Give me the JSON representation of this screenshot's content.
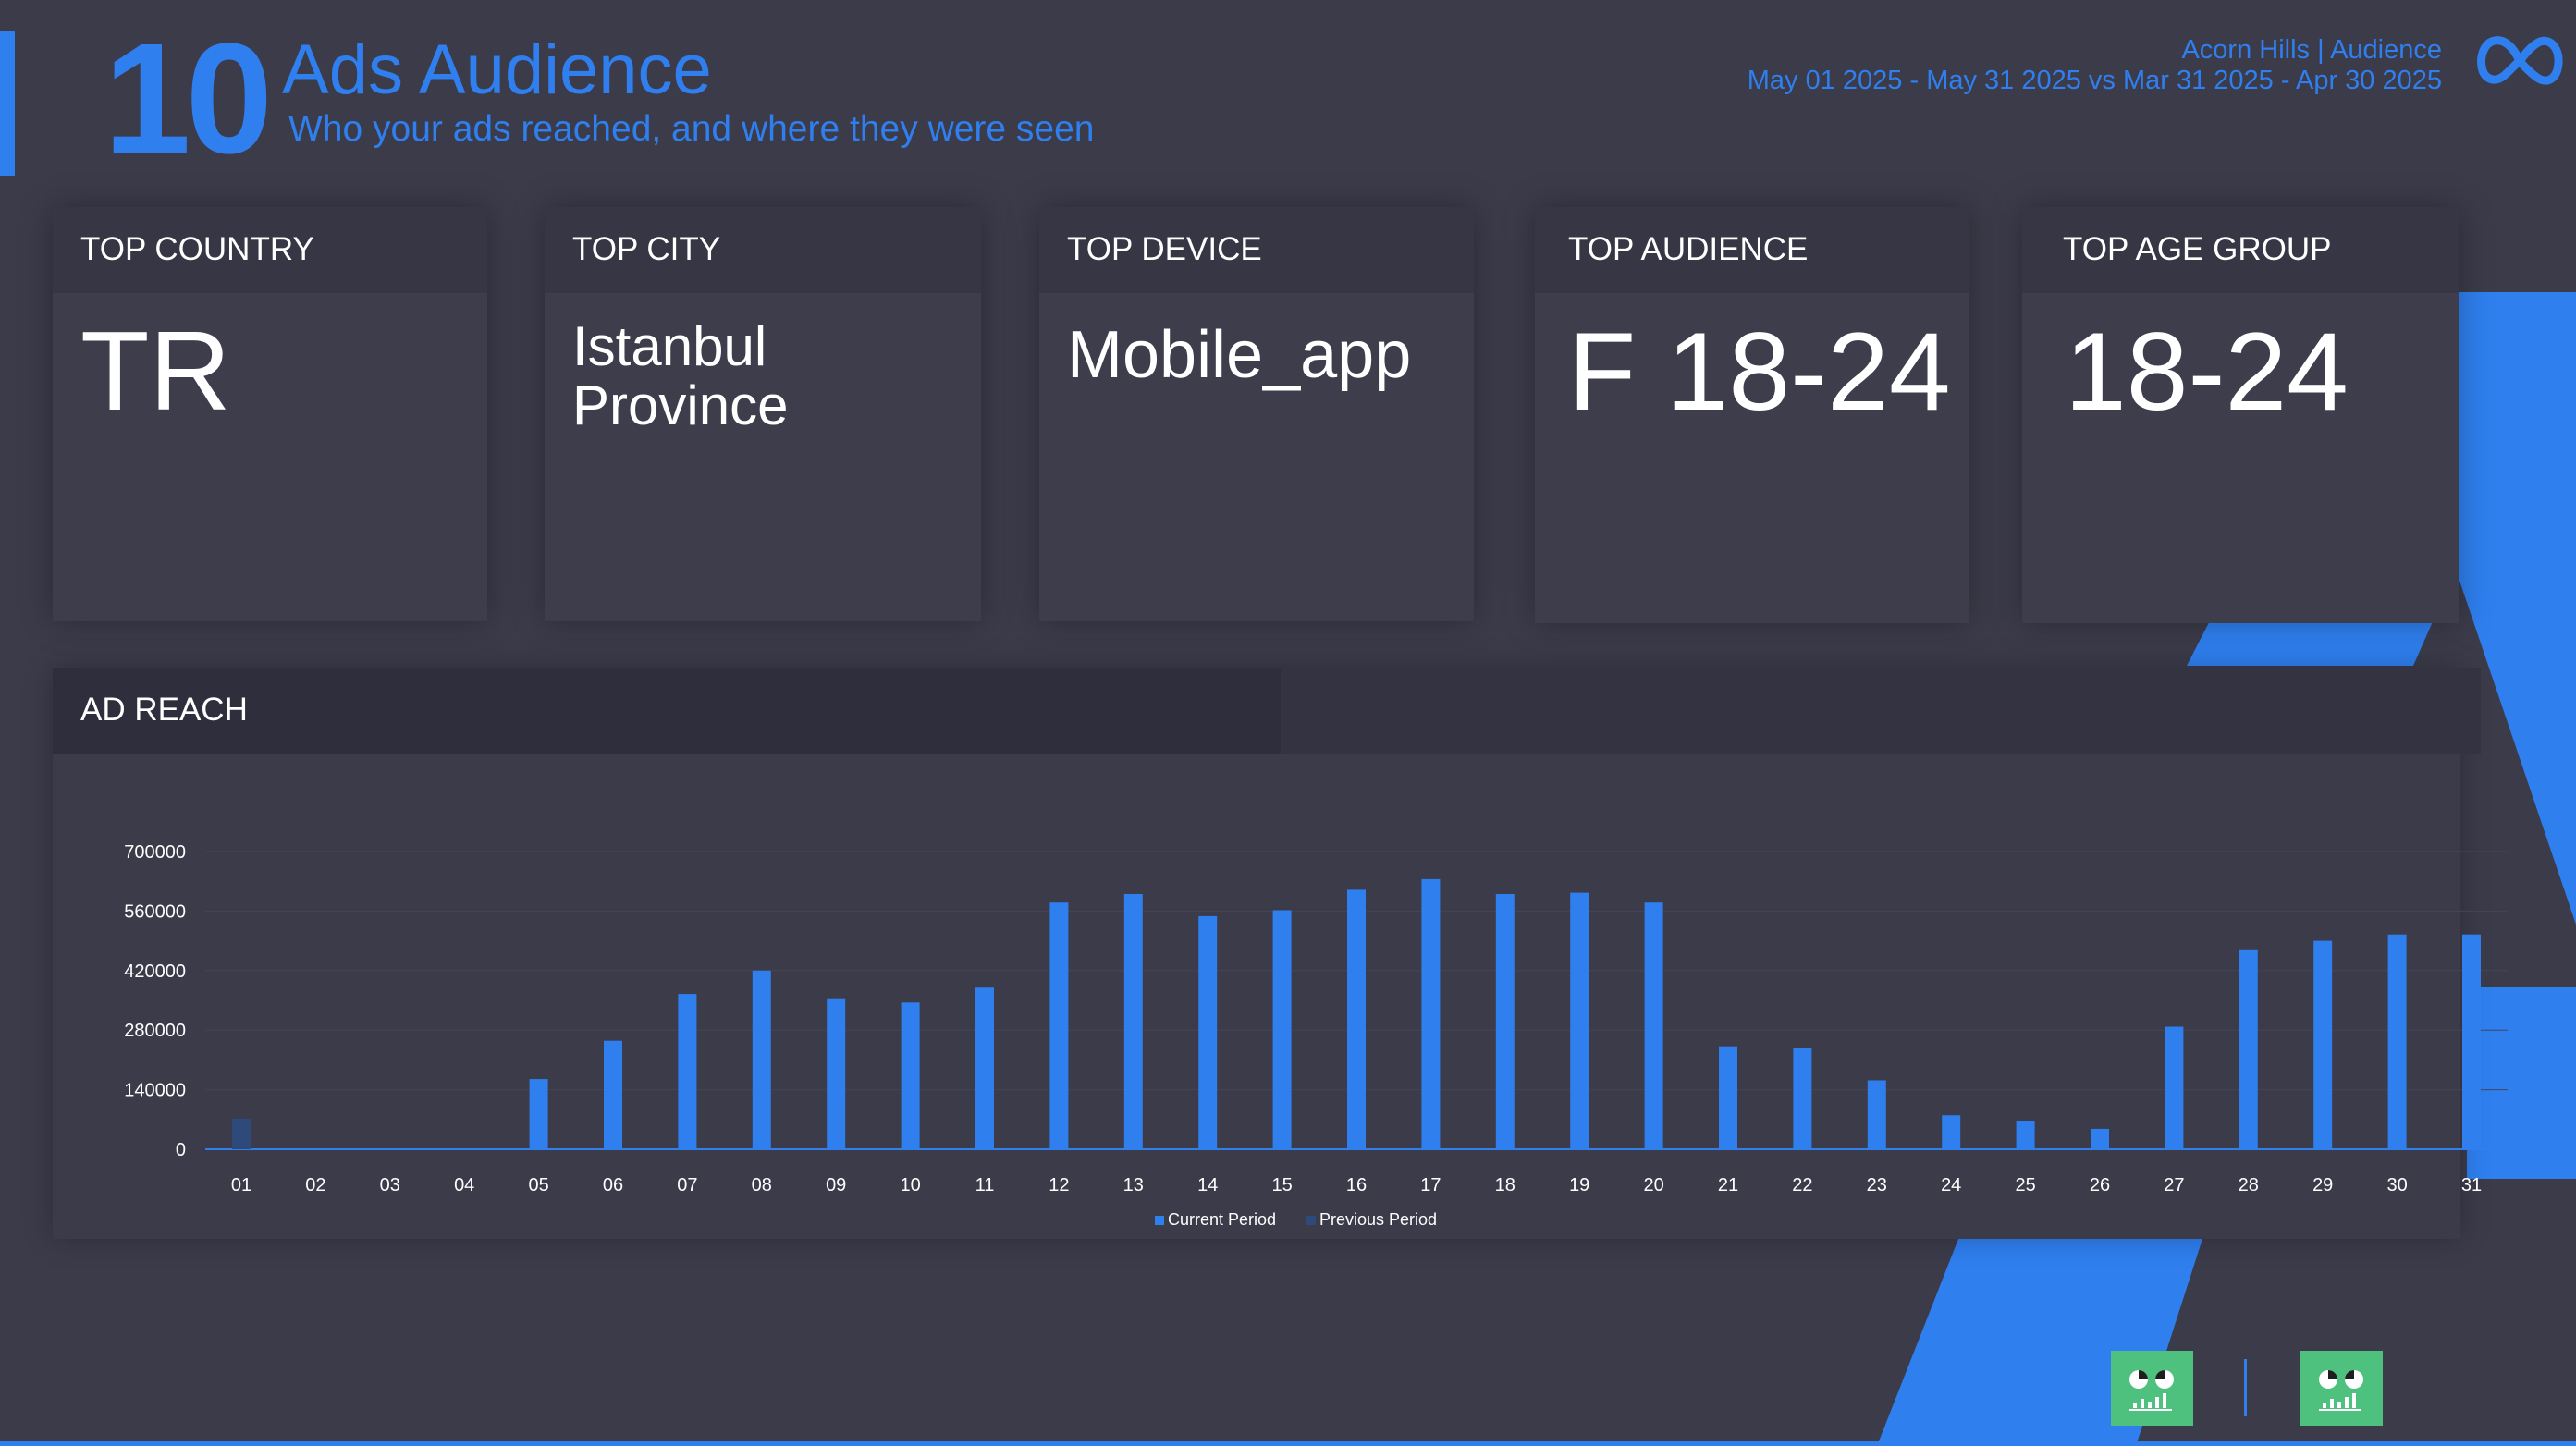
{
  "header": {
    "page_number": "10",
    "title": "Ads Audience",
    "subtitle": "Who your ads reached, and where they were seen",
    "account": "Acorn Hills | Audience",
    "date_range": "May 01 2025 - May 31 2025 vs Mar 31 2025 - Apr 30 2025",
    "logo_icon": "meta-logo-icon"
  },
  "kpis": [
    {
      "label": "TOP COUNTRY",
      "value": "TR"
    },
    {
      "label": "TOP CITY",
      "value": "Istanbul Province"
    },
    {
      "label": "TOP DEVICE",
      "value": "Mobile_app"
    },
    {
      "label": "TOP AUDIENCE",
      "value": "F 18-24"
    },
    {
      "label": "TOP AGE GROUP",
      "value": "18-24"
    }
  ],
  "colors": {
    "accent": "#2f7fef",
    "current_period": "#2f7fef",
    "previous_period": "#2d4a7a",
    "logo_green": "#4fc17e"
  },
  "chart_data": {
    "type": "bar",
    "title": "AD REACH",
    "xlabel": "",
    "ylabel": "",
    "ylim": [
      0,
      700000
    ],
    "yticks": [
      0,
      140000,
      280000,
      420000,
      560000,
      700000
    ],
    "grid": true,
    "legend_position": "bottom",
    "categories": [
      "01",
      "02",
      "03",
      "04",
      "05",
      "06",
      "07",
      "08",
      "09",
      "10",
      "11",
      "12",
      "13",
      "14",
      "15",
      "16",
      "17",
      "18",
      "19",
      "20",
      "21",
      "22",
      "23",
      "24",
      "25",
      "26",
      "27",
      "28",
      "29",
      "30",
      "31"
    ],
    "series": [
      {
        "name": "Current Period",
        "color": "#2f7fef",
        "values": [
          0,
          0,
          0,
          0,
          165000,
          255000,
          365000,
          420000,
          355000,
          345000,
          380000,
          580000,
          600000,
          548000,
          562000,
          610000,
          635000,
          600000,
          603000,
          580000,
          242000,
          237000,
          162000,
          80000,
          67000,
          48000,
          288000,
          470000,
          490000,
          505000,
          505000
        ]
      },
      {
        "name": "Previous Period",
        "color": "#2d4a7a",
        "values": [
          72000,
          0,
          0,
          0,
          0,
          0,
          0,
          0,
          0,
          0,
          0,
          0,
          0,
          0,
          0,
          0,
          0,
          0,
          0,
          0,
          0,
          0,
          0,
          0,
          0,
          0,
          0,
          0,
          0,
          0,
          0
        ]
      }
    ]
  }
}
